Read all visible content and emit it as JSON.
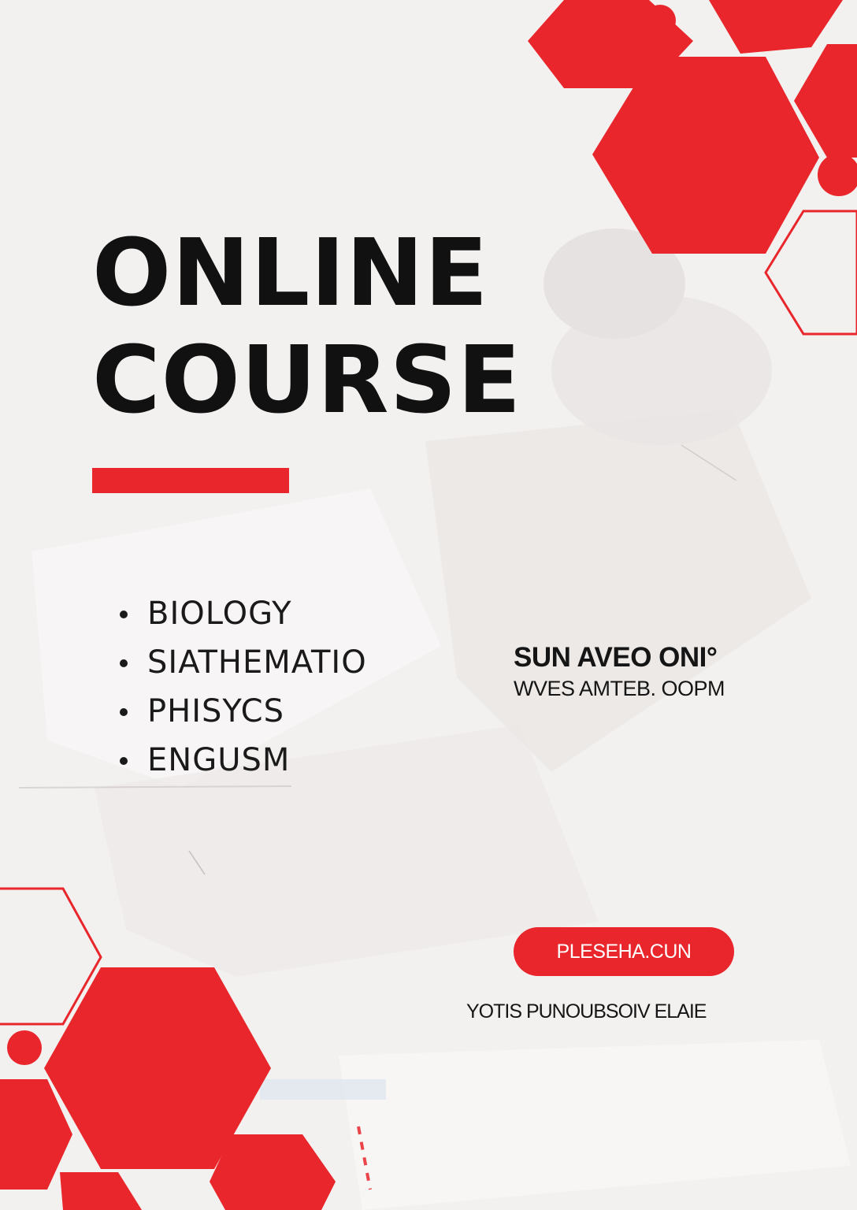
{
  "colors": {
    "accent": "#e8262b",
    "text": "#111111",
    "background": "#f3f1f0"
  },
  "title": {
    "line1": "ONLINE",
    "line2": "COURSE"
  },
  "subjects": [
    "BIOLOGY",
    "SIATHEMATIO",
    "PHISYCS",
    "ENGUSM"
  ],
  "schedule": {
    "days": "SUN AVEO ONI°",
    "time": "WVES AMTEB. OOPM"
  },
  "cta": {
    "label": "PLESEHA.CUN"
  },
  "footer": {
    "note": "YOTIS PUNOUBSOIV ELAIE"
  },
  "icons": {
    "bullet": "bullet-dot-icon"
  }
}
